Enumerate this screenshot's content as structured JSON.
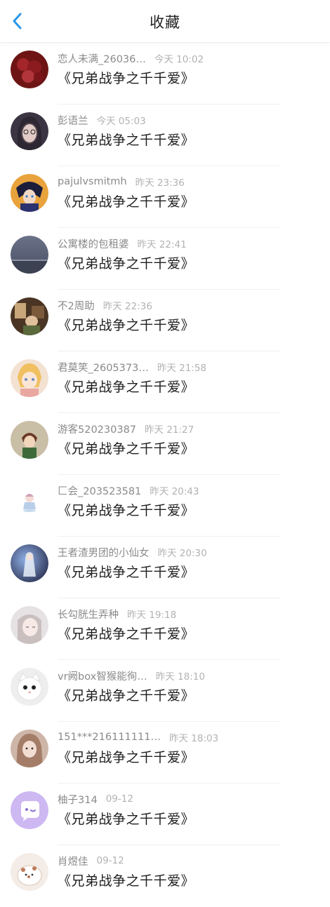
{
  "header": {
    "title": "收藏",
    "back_icon": "chevron-left-icon",
    "accent": "#2a97e8"
  },
  "items": [
    {
      "name": "恋人未满_26036…",
      "time": "今天 10:02",
      "content": "《兄弟战争之千千爱》"
    },
    {
      "name": "彭语兰",
      "time": "今天 05:03",
      "content": "《兄弟战争之千千爱》"
    },
    {
      "name": "pajulvsmitmh",
      "time": "昨天 23:36",
      "content": "《兄弟战争之千千爱》"
    },
    {
      "name": "公寓楼的包租婆",
      "time": "昨天 22:41",
      "content": "《兄弟战争之千千爱》"
    },
    {
      "name": "不2周助",
      "time": "昨天 22:36",
      "content": "《兄弟战争之千千爱》"
    },
    {
      "name": "君莫笑_2605373…",
      "time": "昨天 21:58",
      "content": "《兄弟战争之千千爱》"
    },
    {
      "name": "游客520230387",
      "time": "昨天 21:27",
      "content": "《兄弟战争之千千爱》"
    },
    {
      "name": "匚会_203523581",
      "time": "昨天 20:43",
      "content": "《兄弟战争之千千爱》"
    },
    {
      "name": "王者渣男团的小仙女",
      "time": "昨天 20:30",
      "content": "《兄弟战争之千千爱》"
    },
    {
      "name": "长勾胱生弄种",
      "time": "昨天 19:18",
      "content": "《兄弟战争之千千爱》"
    },
    {
      "name": "vr阙box智猴能徇…",
      "time": "昨天 18:10",
      "content": "《兄弟战争之千千爱》"
    },
    {
      "name": "151***216111111…",
      "time": "昨天 18:03",
      "content": "《兄弟战争之千千爱》"
    },
    {
      "name": "柚子314",
      "time": "09-12",
      "content": "《兄弟战争之千千爱》"
    },
    {
      "name": "肖煜佳",
      "time": "09-12",
      "content": "《兄弟战争之千千爱》"
    }
  ]
}
